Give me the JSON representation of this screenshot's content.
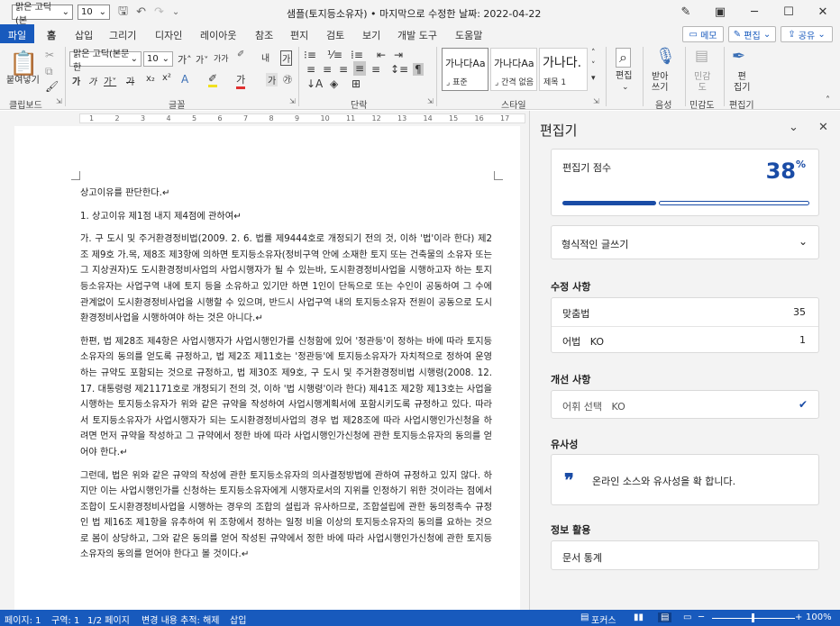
{
  "title": {
    "quick_font": "맑은 고딕(본",
    "quick_size": "10",
    "window_title": "샘플(토지등소유자) • 마지막으로 수정한 날짜: 2022-04-22"
  },
  "tabs": [
    {
      "label": "파일"
    },
    {
      "label": "홈"
    },
    {
      "label": "삽입"
    },
    {
      "label": "그리기"
    },
    {
      "label": "디자인"
    },
    {
      "label": "레이아웃"
    },
    {
      "label": "참조"
    },
    {
      "label": "편지"
    },
    {
      "label": "검토"
    },
    {
      "label": "보기"
    },
    {
      "label": "개발 도구"
    },
    {
      "label": "도움말"
    }
  ],
  "header_buttons": {
    "memo": "메모",
    "edit": "편집",
    "share": "공유"
  },
  "ribbon": {
    "paste_label": "붙여넣기",
    "clipboard_label": "클립보드",
    "font_name": "맑은 고딕(본문 한",
    "font_size": "10",
    "font_group_label": "글꼴",
    "paragraph_group_label": "단락",
    "styles": [
      {
        "sample": "가나다AaE",
        "name": "표준"
      },
      {
        "sample": "가나다AaE",
        "name": "간격 없음"
      },
      {
        "sample": "가나다.",
        "name": "제목 1"
      }
    ],
    "styles_group_label": "스타일",
    "editing_label": "편집",
    "dictate_label": "받아\n쓰기",
    "voice_group_label": "음성",
    "sensitivity_label": "민감\n도",
    "sensitivity_group_label": "민감도",
    "editor_label": "편\n집기",
    "editor_group_label": "편집기"
  },
  "ruler_numbers": [
    "1",
    "2",
    "3",
    "4",
    "5",
    "6",
    "7",
    "8",
    "9",
    "10",
    "11",
    "12",
    "13",
    "14",
    "15",
    "16",
    "17"
  ],
  "document": {
    "paragraphs": [
      "상고이유를 판단한다.",
      "1. 상고이유 제1점 내지 제4점에 관하여",
      "가. 구 도시 및 주거환경정비법(2009. 2. 6. 법률 제9444호로 개정되기 전의 것, 이하 '법'이라 한다) 제2조 제9호 가.목, 제8조 제3항에 의하면 토지등소유자(정비구역 안에 소재한 토지 또는 건축물의 소유자 또는 그 지상권자)도 도시환경정비사업의 사업시행자가 될 수 있는바, 도시환경정비사업을 시행하고자 하는 토지등소유자는 사업구역 내에 토지 등을 소유하고 있기만 하면 1인이 단독으로 또는 수인이 공동하여 그 수에 관계없이 도시환경정비사업을 시행할 수 있으며, 반드시 사업구역 내의 토지등소유자 전원이 공동으로 도시환경정비사업을 시행하여야 하는 것은 아니다.",
      "한편, 법 제28조 제4항은 사업시행자가 사업시행인가를 신청함에 있어 '정관등'이 정하는 바에 따라 토지등소유자의 동의를 얻도록 규정하고, 법 제2조 제11호는 '정관등'에 토지등소유자가 자치적으로 정하여 운영하는 규약도 포함되는 것으로 규정하고, 법 제30조 제9호, 구 도시 및 주거환경정비법 시행령(2008. 12. 17. 대통령령 제21171호로 개정되기 전의 것, 이하 '법 시행령'이라 한다) 제41조 제2항 제13호는 사업을 시행하는 토지등소유자가 위와 같은 규약을 작성하여 사업시행계획서에 포함시키도록 규정하고 있다. 따라서 토지등소유자가 사업시행자가 되는 도시환경정비사업의 경우 법 제28조에 따라 사업시행인가신청을 하려면 먼저 규약을 작성하고 그 규약에서 정한 바에 따라 사업시행인가신청에 관한 토지등소유자의 동의를 얻어야 한다.",
      "그런데, 법은 위와 같은 규약의 작성에 관한 토지등소유자의 의사결정방법에 관하여 규정하고 있지 않다. 하지만 이는 사업시행인가를 신청하는 토지등소유자에게 시행자로서의 지위를 인정하기 위한 것이라는 점에서 조합이 도시환경정비사업을 시행하는 경우의 조합의 설립과 유사하므로, 조합설립에 관한 동의정족수 규정인 법 제16조 제1항을 유추하여 위 조항에서 정하는 일정 비율 이상의 토지등소유자의 동의를 요하는 것으로 봄이 상당하고, 그와 같은 동의를 얻어 작성된 규약에서 정한 바에 따라 사업시행인가신청에 관한 토지등소유자의 동의를 얻어야 한다고 볼 것이다."
    ]
  },
  "editor_panel": {
    "title": "편집기",
    "score_label": "편집기 점수",
    "score_value": "38",
    "score_unit": "%",
    "score_fraction": 0.38,
    "writing_style": "형식적인 글쓰기",
    "corrections_label": "수정 사항",
    "corrections": [
      {
        "label": "맞춤법",
        "count": "35"
      },
      {
        "label": "어법   KO",
        "count": "1"
      }
    ],
    "refinements_label": "개선 사항",
    "refinement_item": "어휘 선택   KO",
    "similarity_label": "유사성",
    "similarity_text": "온라인 소스와 유사성을 확 합니다.",
    "insights_label": "정보 활용",
    "insights_item": "문서 통계"
  },
  "status_bar": {
    "page": "페이지: 1",
    "section": "구역: 1",
    "page_count": "1/2 페이지",
    "track_changes": "변경 내용 추적: 해제",
    "insert_mode": "삽입",
    "focus": "포커스",
    "zoom": "100%"
  },
  "colors": {
    "accent": "#185abd",
    "score_blue": "#1a4ca6",
    "spell_red": "#e03030"
  }
}
